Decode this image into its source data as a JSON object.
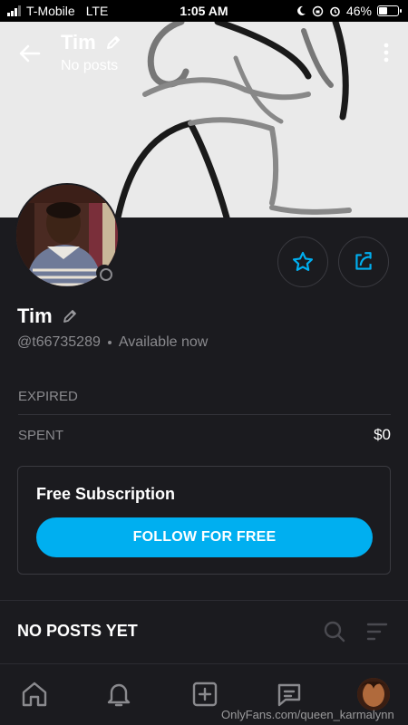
{
  "status_bar": {
    "carrier": "T-Mobile",
    "network": "LTE",
    "time": "1:05 AM",
    "battery": "46%"
  },
  "header": {
    "title": "Tim",
    "subtitle": "No posts"
  },
  "profile": {
    "name": "Tim",
    "handle": "@t66735289",
    "availability": "Available now"
  },
  "stats": [
    {
      "label": "EXPIRED",
      "value": ""
    },
    {
      "label": "SPENT",
      "value": "$0"
    }
  ],
  "subscription": {
    "title": "Free Subscription",
    "button_label": "FOLLOW FOR FREE"
  },
  "posts": {
    "label": "NO POSTS YET"
  },
  "watermark": "OnlyFans.com/queen_karmalynn",
  "colors": {
    "accent": "#00aff0",
    "background": "#1b1b1f"
  },
  "icons": [
    "back-arrow-icon",
    "pencil-icon",
    "more-vertical-icon",
    "star-icon",
    "share-icon",
    "search-icon",
    "sort-icon",
    "home-icon",
    "bell-icon",
    "add-post-icon",
    "messages-icon"
  ]
}
